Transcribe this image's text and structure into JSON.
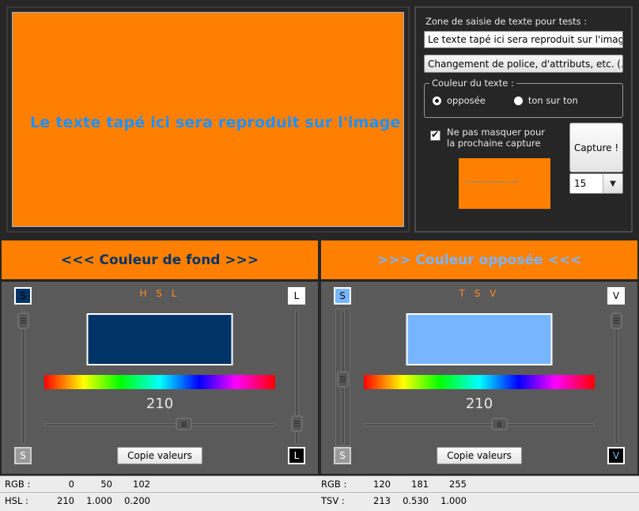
{
  "preview": {
    "text": "Le texte tapé ici sera reproduit sur l'image",
    "bg_color": "#FF8000",
    "text_color": "#1E90FF"
  },
  "controls": {
    "section_label": "Zone de saisie de texte pour tests :",
    "text_input_value": "Le texte tapé ici sera reproduit sur l'image",
    "text_input_placeholder": "Le texte tapé ici sera reproduit sur l'image",
    "font_button_label": "Changement de police, d'attributs, etc. (...)",
    "color_group": {
      "legend": "Couleur du texte :",
      "options": [
        {
          "label": "opposée",
          "selected": true
        },
        {
          "label": "ton sur ton",
          "selected": false
        }
      ]
    },
    "checkbox": {
      "label": "Ne pas masquer pour\nla prochaine capture",
      "checked": true
    },
    "capture_button_label": "Capture !",
    "thumbnail": {
      "bg_color": "#FF8000",
      "text": "Le texte tapé ici sera reproduit sur l'image"
    },
    "delay_combo": {
      "value": "15",
      "arrow_icon": "chevron-down-icon"
    }
  },
  "banners": {
    "left": {
      "label": "<<< Couleur de fond >>>",
      "text_color": "#003366",
      "bg_color": "#FF8000"
    },
    "right": {
      "label": ">>> Couleur opposée <<<",
      "text_color": "#78B5FF",
      "bg_color": "#FF8000"
    }
  },
  "panels": [
    {
      "title": "H S L",
      "sample_color": "#003366",
      "hue_value": "210",
      "copy_button_label": "Copie valeurs",
      "left_axis": {
        "letter": "S",
        "top_label": "S",
        "bottom_label": "S",
        "thumb_pct": 2
      },
      "right_axis": {
        "letter": "L",
        "top_label": "L",
        "bottom_label": "L",
        "thumb_pct": 80
      },
      "hue_thumb_pct": 58
    },
    {
      "title": "T S V",
      "sample_color": "#78B5FF",
      "hue_value": "210",
      "copy_button_label": "Copie valeurs",
      "left_axis": {
        "letter": "S",
        "top_label": "S",
        "bottom_label": "S",
        "thumb_pct": 47
      },
      "right_axis": {
        "letter": "V",
        "top_label": "V",
        "bottom_label": "V",
        "thumb_pct": 2
      },
      "hue_thumb_pct": 56
    }
  ],
  "status": {
    "left": {
      "rgb_label": "RGB :",
      "rgb_values": [
        "0",
        "50",
        "102"
      ],
      "model_label": "HSL :",
      "model_values": [
        "210",
        "1.000",
        "0.200"
      ]
    },
    "right": {
      "rgb_label": "RGB :",
      "rgb_values": [
        "120",
        "181",
        "255"
      ],
      "model_label": "TSV :",
      "model_values": [
        "213",
        "0.530",
        "1.000"
      ]
    }
  }
}
